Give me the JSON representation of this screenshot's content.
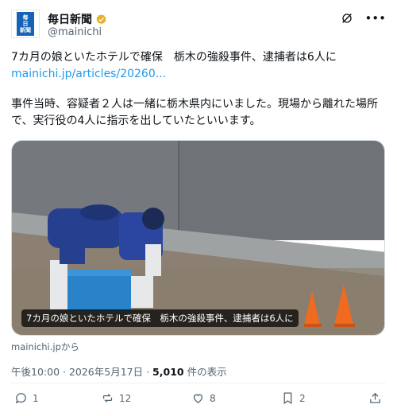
{
  "account": {
    "display_name": "毎日新聞",
    "handle": "@mainichi",
    "logo_text": [
      "毎",
      "日",
      "新聞"
    ],
    "verified_color": "#e8b02a"
  },
  "tweet": {
    "line1": "7カ月の娘といたホテルで確保　栃木の強殺事件、逮捕者は6人に",
    "link": "mainichi.jp/articles/20260...",
    "para2_line1": "事件当時、容疑者２人は一緒に栃木県内にいました。現場から離れた場所",
    "para2_line2": "で、実行役の4人に指示を出していたといいます。"
  },
  "media": {
    "caption": "7カ月の娘といたホテルで確保　栃木の強殺事件、逮捕者は6人に"
  },
  "source": "mainichi.jpから",
  "meta": {
    "time": "午後10:00 · 2026年5月17日 · ",
    "views_count": "5,010",
    "views_label": " 件の表示"
  },
  "actions": {
    "replies": "1",
    "reposts": "12",
    "likes": "8",
    "bookmarks": "2"
  },
  "colors": {
    "link": "#1d9bf0",
    "muted": "#536471",
    "brand": "#1463b6"
  }
}
